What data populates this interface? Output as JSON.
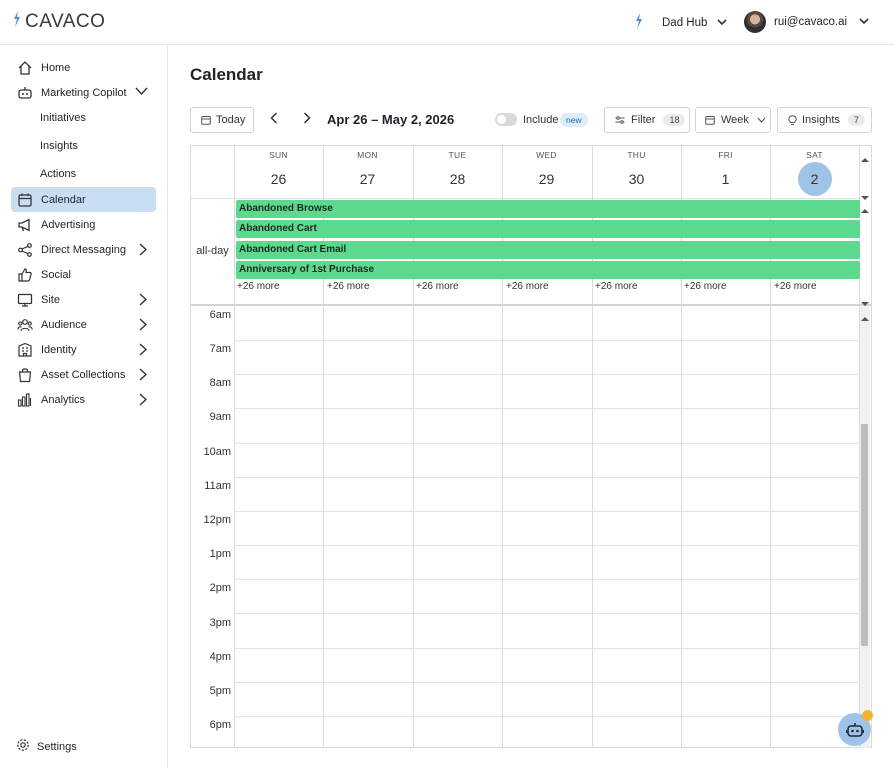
{
  "brand": {
    "name": "CAVACO",
    "accent": "#4a8fd6"
  },
  "header": {
    "workspace": "Dad Hub",
    "user_email": "rui@cavaco.ai"
  },
  "sidebar": {
    "items": [
      {
        "label": "Home",
        "icon": "home-icon"
      },
      {
        "label": "Marketing Copilot",
        "icon": "robot-icon"
      },
      {
        "label": "Calendar",
        "icon": "calendar-icon"
      },
      {
        "label": "Advertising",
        "icon": "megaphone-icon"
      },
      {
        "label": "Direct Messaging",
        "icon": "share-icon"
      },
      {
        "label": "Social",
        "icon": "thumbs-up-icon"
      },
      {
        "label": "Site",
        "icon": "monitor-icon"
      },
      {
        "label": "Audience",
        "icon": "users-icon"
      },
      {
        "label": "Identity",
        "icon": "building-icon"
      },
      {
        "label": "Asset Collections",
        "icon": "bag-icon"
      },
      {
        "label": "Analytics",
        "icon": "bar-chart-icon"
      }
    ],
    "subitems": [
      "Initiatives",
      "Insights",
      "Actions"
    ],
    "settings": "Settings"
  },
  "page": {
    "title": "Calendar"
  },
  "toolbar": {
    "today": "Today",
    "date_range": "Apr 26 – May 2, 2026",
    "include": "Include",
    "new_badge": "new",
    "filter": "Filter",
    "filter_count": "18",
    "view": "Week",
    "insights": "Insights",
    "insights_count": "7"
  },
  "calendar": {
    "days": [
      {
        "dow": "SUN",
        "num": "26"
      },
      {
        "dow": "MON",
        "num": "27"
      },
      {
        "dow": "TUE",
        "num": "28"
      },
      {
        "dow": "WED",
        "num": "29"
      },
      {
        "dow": "THU",
        "num": "30"
      },
      {
        "dow": "FRI",
        "num": "1"
      },
      {
        "dow": "SAT",
        "num": "2"
      }
    ],
    "allday_label": "all-day",
    "events": [
      "Abandoned Browse",
      "Abandoned Cart",
      "Abandoned Cart Email",
      "Anniversary of 1st Purchase"
    ],
    "more_label": "+26 more",
    "hours": [
      "6am",
      "7am",
      "8am",
      "9am",
      "10am",
      "11am",
      "12pm",
      "1pm",
      "2pm",
      "3pm",
      "4pm",
      "5pm",
      "6pm"
    ],
    "event_color": "#5dd88f",
    "today_color": "#9fc3e6"
  }
}
